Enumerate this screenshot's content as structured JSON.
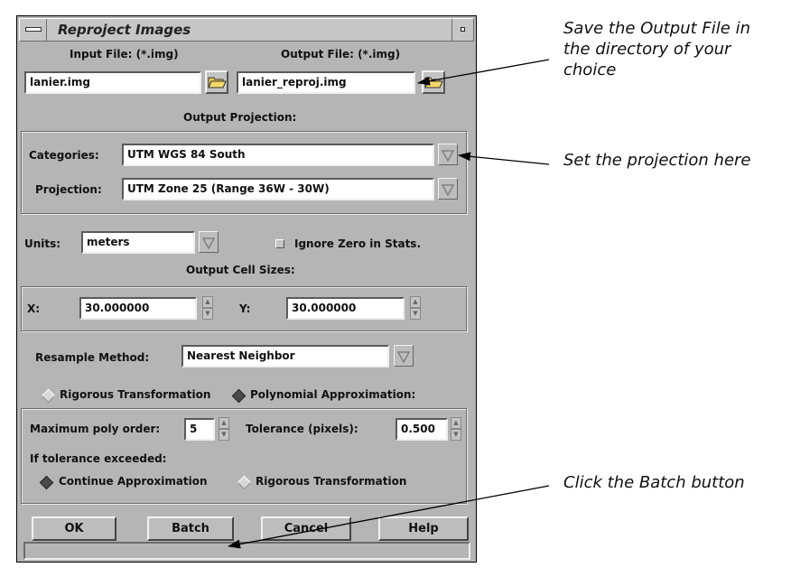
{
  "dialog": {
    "title": "Reproject Images",
    "input_file": {
      "label": "Input File: (*.img)",
      "value": "lanier.img"
    },
    "output_file": {
      "label": "Output File: (*.img)",
      "value": "lanier_reproj.img"
    },
    "output_projection": {
      "heading": "Output Projection:",
      "categories_label": "Categories:",
      "categories_value": "UTM WGS 84 South",
      "projection_label": "Projection:",
      "projection_value": "UTM Zone 25  (Range 36W - 30W)"
    },
    "units": {
      "label": "Units:",
      "value": "meters"
    },
    "ignore_zero": {
      "label": "Ignore Zero in Stats.",
      "checked": false
    },
    "cell_sizes": {
      "heading": "Output Cell Sizes:",
      "x_label": "X:",
      "x_value": "30.000000",
      "y_label": "Y:",
      "y_value": "30.000000"
    },
    "resample": {
      "label": "Resample Method:",
      "value": "Nearest Neighbor"
    },
    "transform": {
      "rigorous_label": "Rigorous Transformation",
      "polynomial_label": "Polynomial Approximation:",
      "selected": "polynomial"
    },
    "poly": {
      "max_order_label": "Maximum poly order:",
      "max_order_value": "5",
      "tolerance_label": "Tolerance (pixels):",
      "tolerance_value": "0.500",
      "exceeded_label": "If tolerance exceeded:",
      "continue_label": "Continue Approximation",
      "rigorous_label": "Rigorous Transformation",
      "selected": "continue"
    },
    "buttons": {
      "ok": "OK",
      "batch": "Batch",
      "cancel": "Cancel",
      "help": "Help"
    }
  },
  "annotations": {
    "save_output": [
      "Save the Output File in",
      "the directory of your",
      "choice"
    ],
    "set_projection": "Set the projection here",
    "click_batch": "Click the Batch button"
  }
}
